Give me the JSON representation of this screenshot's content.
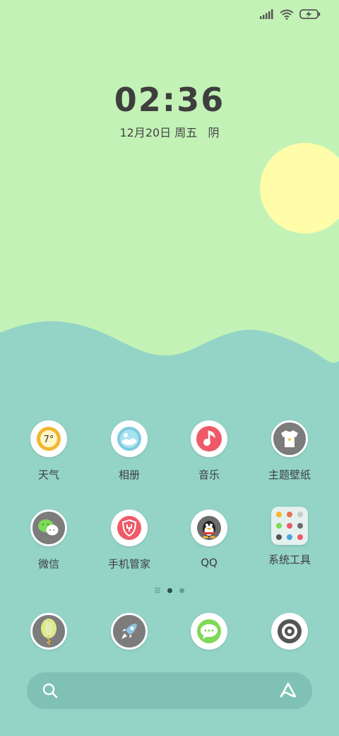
{
  "status_bar": {
    "signal": "signal-icon",
    "wifi": "wifi-icon",
    "battery": "battery-charging-icon"
  },
  "clock": {
    "time": "02:36",
    "date": "12月20日 周五   阴"
  },
  "colors": {
    "sky": "#c3f2b6",
    "sea": "#93d4c7",
    "sun": "#fffcaa",
    "search": "#7fc2b5"
  },
  "weather_icon_text": "7°",
  "apps_row1": [
    {
      "label": "天气",
      "icon": "weather-icon"
    },
    {
      "label": "相册",
      "icon": "gallery-icon"
    },
    {
      "label": "音乐",
      "icon": "music-icon"
    },
    {
      "label": "主题壁纸",
      "icon": "themes-icon"
    }
  ],
  "apps_row2": [
    {
      "label": "微信",
      "icon": "wechat-icon"
    },
    {
      "label": "手机管家",
      "icon": "security-icon"
    },
    {
      "label": "QQ",
      "icon": "qq-icon"
    },
    {
      "label": "系统工具",
      "icon": "folder-icon"
    }
  ],
  "dock": [
    {
      "icon": "browser-icon"
    },
    {
      "icon": "rocket-icon"
    },
    {
      "icon": "messages-icon"
    },
    {
      "icon": "camera-icon"
    }
  ],
  "pager": {
    "pages": 2,
    "current": 1
  },
  "search": {
    "left_icon": "search-icon",
    "right_icon": "assistant-icon"
  }
}
